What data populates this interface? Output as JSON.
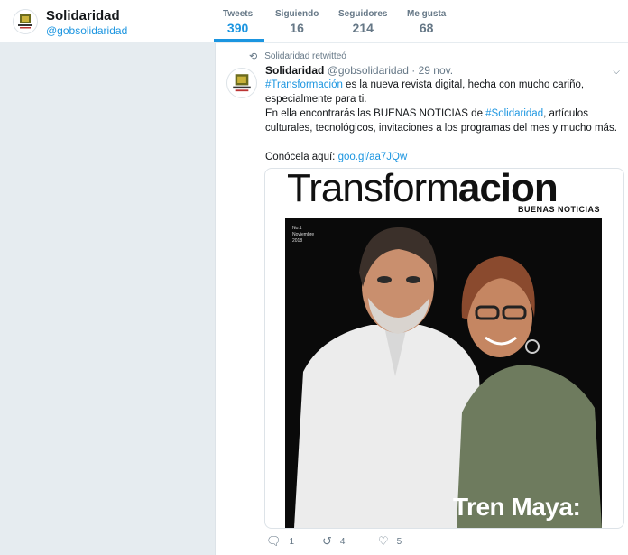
{
  "profile": {
    "name": "Solidaridad",
    "handle": "@gobsolidaridad",
    "avatar_logo_text": "SOLIDARIDAD"
  },
  "stats": [
    {
      "label": "Tweets",
      "value": "390",
      "active": true
    },
    {
      "label": "Siguiendo",
      "value": "16",
      "active": false
    },
    {
      "label": "Seguidores",
      "value": "214",
      "active": false
    },
    {
      "label": "Me gusta",
      "value": "68",
      "active": false
    }
  ],
  "tweet": {
    "retweet_context": "Solidaridad retwitteó",
    "author": "Solidaridad",
    "handle": "@gobsolidaridad",
    "separator": "·",
    "date": "29 nov.",
    "text": {
      "hashtag1": "#Transformación",
      "line1_rest": " es la nueva revista digital, hecha con mucho cariño, especialmente para ti.",
      "line2_start": "En ella encontrarás las BUENAS NOTICIAS de ",
      "hashtag2": "#Solidaridad",
      "line2_rest": ", artículos culturales, tecnológicos, invitaciones a los programas del mes y mucho más.",
      "line3_start": "Conócela aquí: ",
      "link": "goo.gl/aa7JQw"
    },
    "media": {
      "magazine_title_light": "Transform",
      "magazine_title_bold": "acion",
      "magazine_subtitle": "BUENAS NOTICIAS",
      "issue_line1": "No.1",
      "issue_line2": "Noviembre",
      "issue_line3": "2018",
      "headline": "Tren Maya:"
    },
    "actions": {
      "reply_count": "1",
      "retweet_count": "4",
      "like_count": "5"
    }
  },
  "colors": {
    "accent": "#1b95e0",
    "background": "#e6ecf0",
    "muted": "#657786"
  }
}
